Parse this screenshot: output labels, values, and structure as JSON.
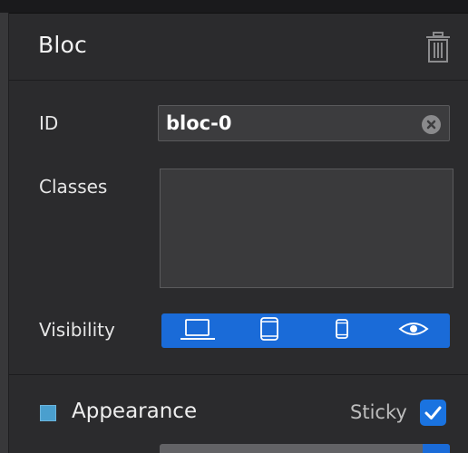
{
  "header": {
    "title": "Bloc",
    "delete_icon": "trash-icon"
  },
  "fields": {
    "id_label": "ID",
    "id_value": "bloc-0",
    "classes_label": "Classes",
    "classes_value": "",
    "visibility_label": "Visibility"
  },
  "visibility": {
    "buttons": [
      {
        "name": "desktop",
        "icon": "laptop-icon"
      },
      {
        "name": "tablet",
        "icon": "tablet-icon"
      },
      {
        "name": "phone",
        "icon": "phone-icon"
      },
      {
        "name": "preview",
        "icon": "eye-icon"
      }
    ],
    "active_color": "#1a6bd8"
  },
  "appearance": {
    "label": "Appearance",
    "swatch_color": "#4a9fce",
    "sticky_label": "Sticky",
    "sticky_checked": true
  }
}
